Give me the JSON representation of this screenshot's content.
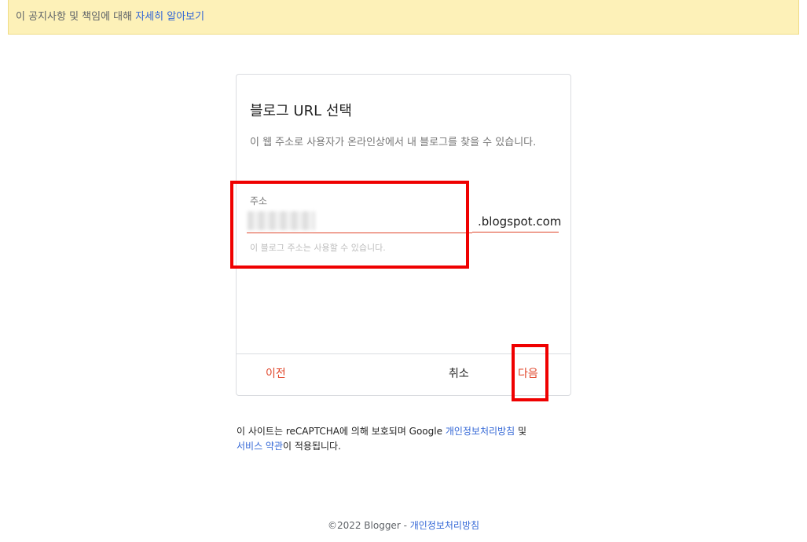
{
  "notice": {
    "text": "이 공지사항 및 책임에 대해 ",
    "link": "자세히 알아보기"
  },
  "card": {
    "title": "블로그 URL 선택",
    "description": "이 웹 주소로 사용자가 온라인상에서 내 블로그를 찾을 수 있습니다.",
    "field": {
      "label": "주소",
      "value": "",
      "suffix": ".blogspot.com",
      "helper": "이 블로그 주소는 사용할 수 있습니다."
    },
    "buttons": {
      "prev": "이전",
      "cancel": "취소",
      "next": "다음"
    }
  },
  "recaptcha": {
    "text1": "이 사이트는 reCAPTCHA에 의해 보호되며 Google ",
    "privacy_link": "개인정보처리방침",
    "text2": " 및",
    "terms_link": "서비스 약관",
    "text3": "이 적용됩니다."
  },
  "footer": {
    "copyright": "©2022 Blogger - ",
    "privacy_link": "개인정보처리방침"
  },
  "colors": {
    "accent": "#e0452a",
    "link": "#3367d6",
    "highlight": "#ef0000",
    "notice_bg": "#fdf1b8"
  }
}
